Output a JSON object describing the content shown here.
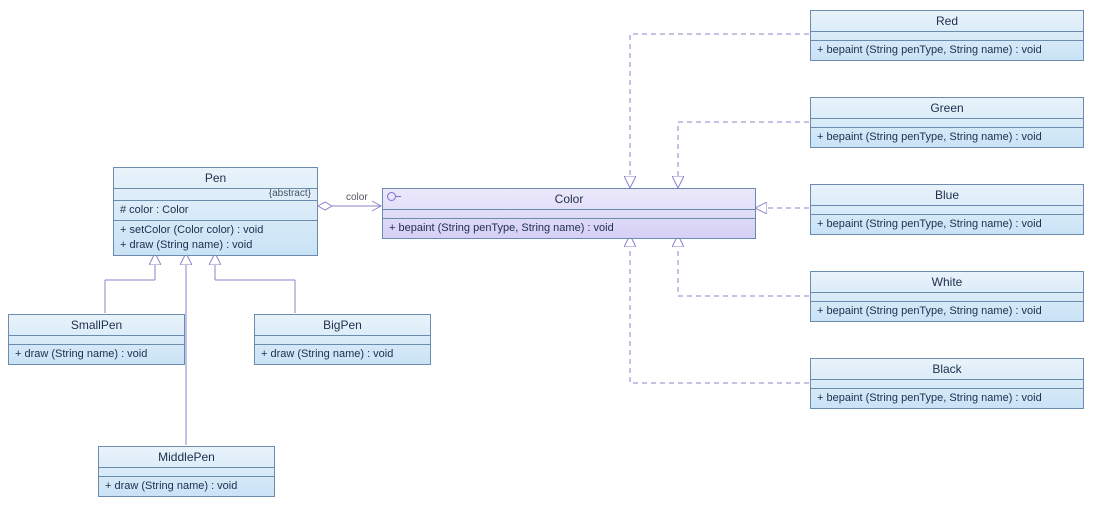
{
  "chart_data": {
    "type": "uml-class-diagram",
    "classes": [
      {
        "id": "Pen",
        "name": "Pen",
        "stereotype": "{abstract}",
        "attributes": [
          "# color : Color"
        ],
        "operations": [
          "+ setColor (Color color) : void",
          "+ draw (String name) : void"
        ]
      },
      {
        "id": "Color",
        "name": "Color",
        "kind": "interface",
        "attributes": [],
        "operations": [
          "+ bepaint (String penType, String name) : void"
        ]
      },
      {
        "id": "SmallPen",
        "name": "SmallPen",
        "operations": [
          "+ draw (String name) : void"
        ]
      },
      {
        "id": "MiddlePen",
        "name": "MiddlePen",
        "operations": [
          "+ draw (String name) : void"
        ]
      },
      {
        "id": "BigPen",
        "name": "BigPen",
        "operations": [
          "+ draw (String name) : void"
        ]
      },
      {
        "id": "Red",
        "name": "Red",
        "operations": [
          "+ bepaint (String penType, String name) : void"
        ]
      },
      {
        "id": "Green",
        "name": "Green",
        "operations": [
          "+ bepaint (String penType, String name) : void"
        ]
      },
      {
        "id": "Blue",
        "name": "Blue",
        "operations": [
          "+ bepaint (String penType, String name) : void"
        ]
      },
      {
        "id": "White",
        "name": "White",
        "operations": [
          "+ bepaint (String penType, String name) : void"
        ]
      },
      {
        "id": "Black",
        "name": "Black",
        "operations": [
          "+ bepaint (String penType, String name) : void"
        ]
      }
    ],
    "relations": [
      {
        "type": "aggregation",
        "from": "Pen",
        "to": "Color",
        "role": "color"
      },
      {
        "type": "generalization",
        "from": "SmallPen",
        "to": "Pen"
      },
      {
        "type": "generalization",
        "from": "MiddlePen",
        "to": "Pen"
      },
      {
        "type": "generalization",
        "from": "BigPen",
        "to": "Pen"
      },
      {
        "type": "realization",
        "from": "Red",
        "to": "Color"
      },
      {
        "type": "realization",
        "from": "Green",
        "to": "Color"
      },
      {
        "type": "realization",
        "from": "Blue",
        "to": "Color"
      },
      {
        "type": "realization",
        "from": "White",
        "to": "Color"
      },
      {
        "type": "realization",
        "from": "Black",
        "to": "Color"
      }
    ]
  },
  "label_color": "color",
  "pen": {
    "name": "Pen",
    "stereotype": "{abstract}",
    "attr0": "#  color  :  Color",
    "op0": "+  setColor (Color color)  : void",
    "op1": "+  draw (String name)       : void"
  },
  "color": {
    "name": "Color",
    "op0": "+  bepaint (String penType, String name)   : void"
  },
  "small": {
    "name": "SmallPen",
    "op0": "+  draw (String name)  : void"
  },
  "middle": {
    "name": "MiddlePen",
    "op0": "+  draw (String name)  : void"
  },
  "big": {
    "name": "BigPen",
    "op0": "+  draw (String name)  : void"
  },
  "red": {
    "name": "Red",
    "op0": "+  bepaint (String penType, String name)   : void"
  },
  "green": {
    "name": "Green",
    "op0": "+  bepaint (String penType, String name)   : void"
  },
  "blue": {
    "name": "Blue",
    "op0": "+  bepaint (String penType, String name)   : void"
  },
  "white": {
    "name": "White",
    "op0": "+  bepaint (String penType, String name)   : void"
  },
  "black": {
    "name": "Black",
    "op0": "+  bepaint (String penType, String name)   : void"
  }
}
